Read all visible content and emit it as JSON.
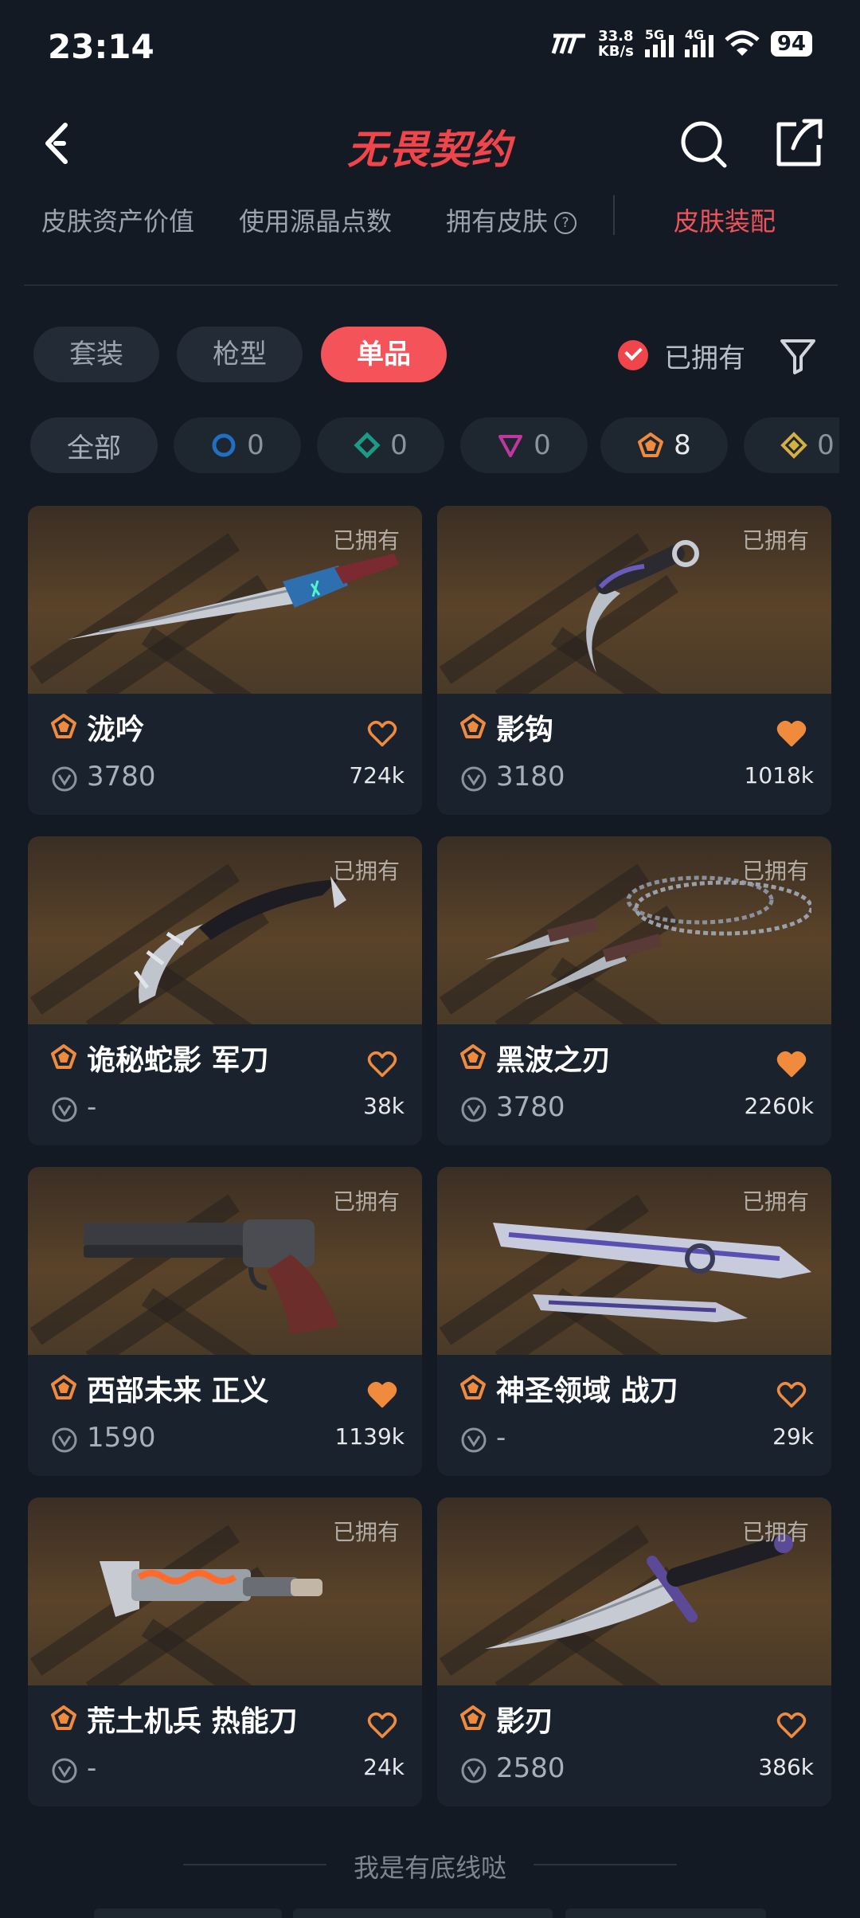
{
  "status": {
    "time": "23:14",
    "speed_top": "33.8",
    "speed_bottom": "KB/s",
    "sig1": "5G",
    "sig2": "4G",
    "battery": "94"
  },
  "app": {
    "title": "无畏契约"
  },
  "tabs": [
    {
      "label": "皮肤资产价值"
    },
    {
      "label": "使用源晶点数"
    },
    {
      "label": "拥有皮肤"
    },
    {
      "label": "皮肤装配"
    }
  ],
  "segments": [
    {
      "label": "套装"
    },
    {
      "label": "枪型"
    },
    {
      "label": "单品"
    }
  ],
  "owned_filter": {
    "label": "已拥有",
    "checked": true
  },
  "rarity_chips": [
    {
      "label": "全部"
    },
    {
      "count": "0",
      "color": "#1f6fc2"
    },
    {
      "count": "0",
      "color": "#1b9a86"
    },
    {
      "count": "0",
      "color": "#c0389e"
    },
    {
      "count": "8",
      "color": "#f08a3c"
    },
    {
      "count": "0",
      "color": "#d4b040"
    }
  ],
  "owned_label": "已拥有",
  "cards": [
    {
      "name": "泷吟",
      "price": "3780",
      "likes": "724k",
      "liked": false,
      "weapon": "kunai"
    },
    {
      "name": "影钩",
      "price": "3180",
      "likes": "1018k",
      "liked": true,
      "weapon": "karambit"
    },
    {
      "name": "诡秘蛇影 军刀",
      "price": "-",
      "likes": "38k",
      "liked": false,
      "weapon": "claw"
    },
    {
      "name": "黑波之刃",
      "price": "3780",
      "likes": "2260k",
      "liked": true,
      "weapon": "chain"
    },
    {
      "name": "西部未来 正义",
      "price": "1590",
      "likes": "1139k",
      "liked": true,
      "weapon": "revolver"
    },
    {
      "name": "神圣领域 战刀",
      "price": "-",
      "likes": "29k",
      "liked": false,
      "weapon": "dual"
    },
    {
      "name": "荒土机兵 热能刀",
      "price": "-",
      "likes": "24k",
      "liked": false,
      "weapon": "cleaver"
    },
    {
      "name": "影刃",
      "price": "2580",
      "likes": "386k",
      "liked": false,
      "weapon": "dagger"
    }
  ],
  "footer": {
    "text": "我是有底线哒"
  },
  "colors": {
    "accent": "#f0454a",
    "rank": "#f08a3c",
    "background": "#131a24",
    "card": "#1a222d"
  }
}
